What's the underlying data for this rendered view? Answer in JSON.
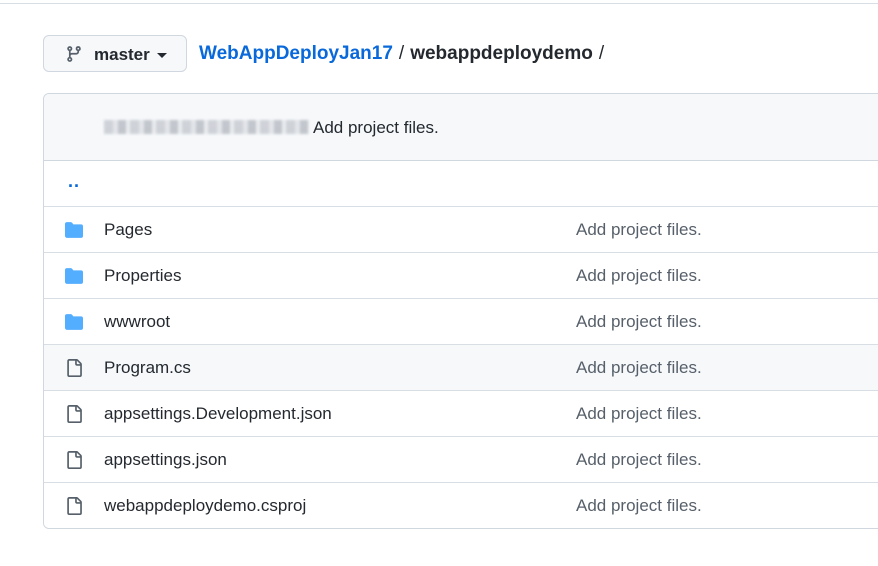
{
  "branch": {
    "label": "master",
    "icon": "git-branch-icon"
  },
  "breadcrumb": {
    "repo": "WebAppDeployJan17",
    "separator": "/",
    "current": "webappdeploydemo",
    "trailing_separator": "/"
  },
  "commit": {
    "author_redacted": "(blurred author)",
    "message": "Add project files."
  },
  "parent_dir": {
    "label": ".."
  },
  "files": [
    {
      "type": "folder",
      "icon": "folder-icon",
      "name": "Pages",
      "message": "Add project files."
    },
    {
      "type": "folder",
      "icon": "folder-icon",
      "name": "Properties",
      "message": "Add project files."
    },
    {
      "type": "folder",
      "icon": "folder-icon",
      "name": "wwwroot",
      "message": "Add project files."
    },
    {
      "type": "file",
      "icon": "file-icon",
      "name": "Program.cs",
      "message": "Add project files.",
      "hovered": true
    },
    {
      "type": "file",
      "icon": "file-icon",
      "name": "appsettings.Development.json",
      "message": "Add project files."
    },
    {
      "type": "file",
      "icon": "file-icon",
      "name": "appsettings.json",
      "message": "Add project files."
    },
    {
      "type": "file",
      "icon": "file-icon",
      "name": "webappdeploydemo.csproj",
      "message": "Add project files."
    }
  ],
  "colors": {
    "link": "#0969da",
    "folder": "#54aeff",
    "text": "#24292f",
    "muted": "#57606a",
    "border": "#d0d7de",
    "header_bg": "#f6f8fa"
  }
}
